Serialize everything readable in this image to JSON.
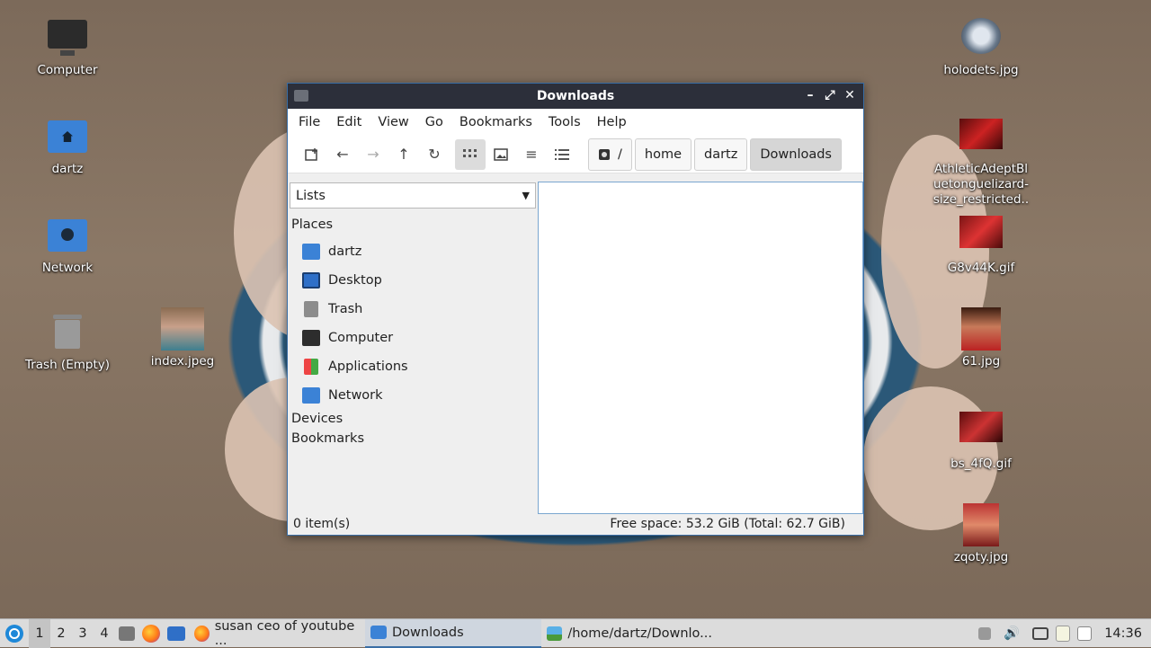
{
  "desktop": {
    "left_icons": [
      {
        "label": "Computer"
      },
      {
        "label": "dartz"
      },
      {
        "label": "Network"
      },
      {
        "label": "Trash (Empty)"
      },
      {
        "label": "index.jpeg"
      }
    ],
    "right_icons": [
      {
        "label": "holodets.jpg"
      },
      {
        "label": "AthleticAdeptBluetonguelizard-size_restricted..."
      },
      {
        "label": "G8v44K.gif"
      },
      {
        "label": "61.jpg"
      },
      {
        "label": "bs_4fQ.gif"
      },
      {
        "label": "zqoty.jpg"
      }
    ]
  },
  "window": {
    "title": "Downloads",
    "controls": {
      "minimize": "–",
      "maximize": "⤢",
      "close": "✕"
    },
    "menu": [
      "File",
      "Edit",
      "View",
      "Go",
      "Bookmarks",
      "Tools",
      "Help"
    ],
    "breadcrumb": [
      "/",
      "home",
      "dartz",
      "Downloads"
    ],
    "sidebar": {
      "mode": "Lists",
      "places_header": "Places",
      "places": [
        "dartz",
        "Desktop",
        "Trash",
        "Computer",
        "Applications",
        "Network"
      ],
      "devices_header": "Devices",
      "bookmarks_header": "Bookmarks"
    },
    "status": {
      "items": "0 item(s)",
      "free_space": "Free space: 53.2 GiB (Total: 62.7 GiB)"
    }
  },
  "taskbar": {
    "workspaces": [
      "1",
      "2",
      "3",
      "4"
    ],
    "tasks": [
      {
        "label": "susan ceo of youtube ..."
      },
      {
        "label": "Downloads"
      },
      {
        "label": "/home/dartz/Downlo..."
      }
    ],
    "clock": "14:36"
  }
}
